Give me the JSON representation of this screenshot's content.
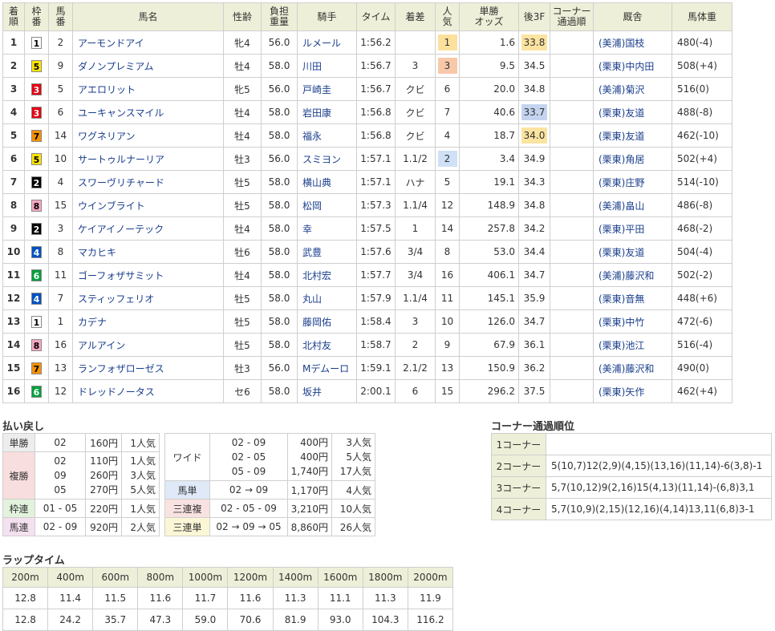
{
  "results": {
    "headers": [
      "着\n順",
      "枠\n番",
      "馬\n番",
      "馬名",
      "性齢",
      "負担\n重量",
      "騎手",
      "タイム",
      "着差",
      "人\n気",
      "単勝\nオッズ",
      "後3F",
      "コーナー\n通過順",
      "厩舎",
      "馬体重"
    ],
    "rows": [
      {
        "rank": "1",
        "waku": "1",
        "umaban": "2",
        "name": "アーモンドアイ",
        "sex_age": "牝4",
        "weight": "56.0",
        "jockey": "ルメール",
        "time": "1:56.2",
        "margin": "",
        "pop": "1",
        "odds": "1.6",
        "f3": "33.8",
        "corner": "",
        "stable": "(美浦)国枝",
        "bw": "480(-4)"
      },
      {
        "rank": "2",
        "waku": "5",
        "umaban": "9",
        "name": "ダノンプレミアム",
        "sex_age": "牡4",
        "weight": "58.0",
        "jockey": "川田",
        "time": "1:56.7",
        "margin": "3",
        "pop": "3",
        "odds": "9.5",
        "f3": "34.5",
        "corner": "",
        "stable": "(栗東)中内田",
        "bw": "508(+4)"
      },
      {
        "rank": "3",
        "waku": "3",
        "umaban": "5",
        "name": "アエロリット",
        "sex_age": "牝5",
        "weight": "56.0",
        "jockey": "戸崎圭",
        "time": "1:56.7",
        "margin": "クビ",
        "pop": "6",
        "odds": "20.0",
        "f3": "34.8",
        "corner": "",
        "stable": "(美浦)菊沢",
        "bw": "516(0)"
      },
      {
        "rank": "4",
        "waku": "3",
        "umaban": "6",
        "name": "ユーキャンスマイル",
        "sex_age": "牡4",
        "weight": "58.0",
        "jockey": "岩田康",
        "time": "1:56.8",
        "margin": "クビ",
        "pop": "7",
        "odds": "40.6",
        "f3": "33.7",
        "corner": "",
        "stable": "(栗東)友道",
        "bw": "488(-8)"
      },
      {
        "rank": "5",
        "waku": "7",
        "umaban": "14",
        "name": "ワグネリアン",
        "sex_age": "牡4",
        "weight": "58.0",
        "jockey": "福永",
        "time": "1:56.8",
        "margin": "クビ",
        "pop": "4",
        "odds": "18.7",
        "f3": "34.0",
        "corner": "",
        "stable": "(栗東)友道",
        "bw": "462(-10)"
      },
      {
        "rank": "6",
        "waku": "5",
        "umaban": "10",
        "name": "サートゥルナーリア",
        "sex_age": "牡3",
        "weight": "56.0",
        "jockey": "スミヨン",
        "time": "1:57.1",
        "margin": "1.1/2",
        "pop": "2",
        "odds": "3.4",
        "f3": "34.9",
        "corner": "",
        "stable": "(栗東)角居",
        "bw": "502(+4)"
      },
      {
        "rank": "7",
        "waku": "2",
        "umaban": "4",
        "name": "スワーヴリチャード",
        "sex_age": "牡5",
        "weight": "58.0",
        "jockey": "横山典",
        "time": "1:57.1",
        "margin": "ハナ",
        "pop": "5",
        "odds": "19.1",
        "f3": "34.3",
        "corner": "",
        "stable": "(栗東)庄野",
        "bw": "514(-10)"
      },
      {
        "rank": "8",
        "waku": "8",
        "umaban": "15",
        "name": "ウインブライト",
        "sex_age": "牡5",
        "weight": "58.0",
        "jockey": "松岡",
        "time": "1:57.3",
        "margin": "1.1/4",
        "pop": "12",
        "odds": "148.9",
        "f3": "34.8",
        "corner": "",
        "stable": "(美浦)畠山",
        "bw": "486(-8)"
      },
      {
        "rank": "9",
        "waku": "2",
        "umaban": "3",
        "name": "ケイアイノーテック",
        "sex_age": "牡4",
        "weight": "58.0",
        "jockey": "幸",
        "time": "1:57.5",
        "margin": "1",
        "pop": "14",
        "odds": "257.8",
        "f3": "34.2",
        "corner": "",
        "stable": "(栗東)平田",
        "bw": "468(-2)"
      },
      {
        "rank": "10",
        "waku": "4",
        "umaban": "8",
        "name": "マカヒキ",
        "sex_age": "牡6",
        "weight": "58.0",
        "jockey": "武豊",
        "time": "1:57.6",
        "margin": "3/4",
        "pop": "8",
        "odds": "53.0",
        "f3": "34.4",
        "corner": "",
        "stable": "(栗東)友道",
        "bw": "504(-4)"
      },
      {
        "rank": "11",
        "waku": "6",
        "umaban": "11",
        "name": "ゴーフォザサミット",
        "sex_age": "牡4",
        "weight": "58.0",
        "jockey": "北村宏",
        "time": "1:57.7",
        "margin": "3/4",
        "pop": "16",
        "odds": "406.1",
        "f3": "34.7",
        "corner": "",
        "stable": "(美浦)藤沢和",
        "bw": "502(-2)"
      },
      {
        "rank": "12",
        "waku": "4",
        "umaban": "7",
        "name": "スティッフェリオ",
        "sex_age": "牡5",
        "weight": "58.0",
        "jockey": "丸山",
        "time": "1:57.9",
        "margin": "1.1/4",
        "pop": "11",
        "odds": "145.1",
        "f3": "35.9",
        "corner": "",
        "stable": "(栗東)音無",
        "bw": "448(+6)"
      },
      {
        "rank": "13",
        "waku": "1",
        "umaban": "1",
        "name": "カデナ",
        "sex_age": "牡5",
        "weight": "58.0",
        "jockey": "藤岡佑",
        "time": "1:58.4",
        "margin": "3",
        "pop": "10",
        "odds": "126.0",
        "f3": "34.7",
        "corner": "",
        "stable": "(栗東)中竹",
        "bw": "472(-6)"
      },
      {
        "rank": "14",
        "waku": "8",
        "umaban": "16",
        "name": "アルアイン",
        "sex_age": "牡5",
        "weight": "58.0",
        "jockey": "北村友",
        "time": "1:58.7",
        "margin": "2",
        "pop": "9",
        "odds": "67.9",
        "f3": "36.1",
        "corner": "",
        "stable": "(栗東)池江",
        "bw": "516(-4)"
      },
      {
        "rank": "15",
        "waku": "7",
        "umaban": "13",
        "name": "ランフォザローゼス",
        "sex_age": "牡3",
        "weight": "56.0",
        "jockey": "Mデムーロ",
        "time": "1:59.1",
        "margin": "2.1/2",
        "pop": "13",
        "odds": "150.9",
        "f3": "36.2",
        "corner": "",
        "stable": "(美浦)藤沢和",
        "bw": "490(0)"
      },
      {
        "rank": "16",
        "waku": "6",
        "umaban": "12",
        "name": "ドレッドノータス",
        "sex_age": "セ6",
        "weight": "58.0",
        "jockey": "坂井",
        "time": "2:00.1",
        "margin": "6",
        "pop": "15",
        "odds": "296.2",
        "f3": "37.5",
        "corner": "",
        "stable": "(栗東)矢作",
        "bw": "462(+4)"
      }
    ]
  },
  "colors": {
    "waku": {
      "1": "#ffffff",
      "2": "#000000",
      "3": "#e60012",
      "4": "#0051c3",
      "5": "#ffe600",
      "6": "#00a03c",
      "7": "#f79100",
      "8": "#f7a8c4"
    },
    "waku_text": {
      "1": "#000000",
      "2": "#ffffff",
      "3": "#ffffff",
      "4": "#ffffff",
      "5": "#000000",
      "6": "#ffffff",
      "7": "#000000",
      "8": "#000000"
    },
    "pop1": "#fbe19c",
    "pop2": "#cfe0f7",
    "pop3": "#f8c9a8",
    "f3_top": "#c4d4f0",
    "f3_2nd": "#fbe3a0",
    "f3_3rd": "#fbe3a0"
  },
  "payout": {
    "title": "払い戻し",
    "left": [
      {
        "label": "単勝",
        "cls": "lab-tan",
        "nums": [
          "02"
        ],
        "amts": [
          "160円"
        ],
        "pops": [
          "1人気"
        ]
      },
      {
        "label": "複勝",
        "cls": "lab-fuku",
        "nums": [
          "02",
          "09",
          "05"
        ],
        "amts": [
          "110円",
          "260円",
          "270円"
        ],
        "pops": [
          "1人気",
          "3人気",
          "5人気"
        ]
      },
      {
        "label": "枠連",
        "cls": "lab-waku",
        "nums": [
          "01 - 05"
        ],
        "amts": [
          "220円"
        ],
        "pops": [
          "1人気"
        ]
      },
      {
        "label": "馬連",
        "cls": "lab-umaren",
        "nums": [
          "02 - 09"
        ],
        "amts": [
          "920円"
        ],
        "pops": [
          "2人気"
        ]
      }
    ],
    "right": [
      {
        "label": "ワイド",
        "cls": "lab-wide",
        "nums": [
          "02 - 09",
          "02 - 05",
          "05 - 09"
        ],
        "amts": [
          "400円",
          "400円",
          "1,740円"
        ],
        "pops": [
          "3人気",
          "5人気",
          "17人気"
        ]
      },
      {
        "label": "馬単",
        "cls": "lab-umatan",
        "nums": [
          "02 → 09"
        ],
        "amts": [
          "1,170円"
        ],
        "pops": [
          "4人気"
        ]
      },
      {
        "label": "三連複",
        "cls": "lab-sanfuku",
        "nums": [
          "02 - 05 - 09"
        ],
        "amts": [
          "3,210円"
        ],
        "pops": [
          "10人気"
        ]
      },
      {
        "label": "三連単",
        "cls": "lab-santan",
        "nums": [
          "02 → 09 → 05"
        ],
        "amts": [
          "8,860円"
        ],
        "pops": [
          "26人気"
        ]
      }
    ]
  },
  "corner": {
    "title": "コーナー通過順位",
    "rows": [
      {
        "label": "1コーナー",
        "value": ""
      },
      {
        "label": "2コーナー",
        "value": "5(10,7)12(2,9)(4,15)(13,16)(11,14)-6(3,8)-1"
      },
      {
        "label": "3コーナー",
        "value": "5,7(10,12)9(2,16)15(4,13)(11,14)-(6,8)3,1"
      },
      {
        "label": "4コーナー",
        "value": "5,7(10,9)(2,15)(12,16)(4,14)13,11(6,8)3-1"
      }
    ]
  },
  "lap": {
    "title": "ラップタイム",
    "headers": [
      "200m",
      "400m",
      "600m",
      "800m",
      "1000m",
      "1200m",
      "1400m",
      "1600m",
      "1800m",
      "2000m"
    ],
    "lap": [
      "12.8",
      "11.4",
      "11.5",
      "11.6",
      "11.7",
      "11.6",
      "11.3",
      "11.1",
      "11.3",
      "11.9"
    ],
    "cumulative": [
      "12.8",
      "24.2",
      "35.7",
      "47.3",
      "59.0",
      "70.6",
      "81.9",
      "93.0",
      "104.3",
      "116.2"
    ]
  }
}
